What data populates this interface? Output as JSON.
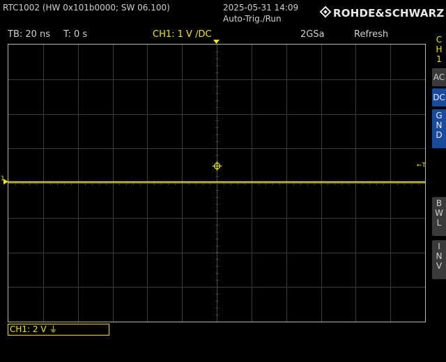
{
  "header": {
    "device_info": "RTC1002 (HW 0x101b0000; SW 06.100)",
    "datetime": "2025-05-31 14:09",
    "trigger_mode": "Auto-Trig./Run",
    "brand": "ROHDE&SCHWARZ"
  },
  "status_bar": {
    "timebase": "TB: 20 ns",
    "trigger_time": "T: 0 s",
    "channel_setting": "CH1: 1 V ∕DC",
    "sample_rate": "2GSa",
    "acquisition_mode": "Refresh"
  },
  "side_menu": {
    "channel": "C\nH\n1",
    "coupling_ac": "AC",
    "coupling_dc": "DC",
    "coupling_gnd": "G\nN\nD",
    "bandwidth_limit": "B\nW\nL",
    "invert": "I\nN\nV"
  },
  "waveform": {
    "channel_marker": "1",
    "trigger_marker": "←T",
    "level_fraction_from_top": 0.495
  },
  "footer": {
    "ch1_scale": "CH1: 2 V ⏚"
  },
  "colors": {
    "channel1": "#f2e600",
    "grid": "#3c3c3c",
    "selected_button": "#1a4a9a"
  }
}
